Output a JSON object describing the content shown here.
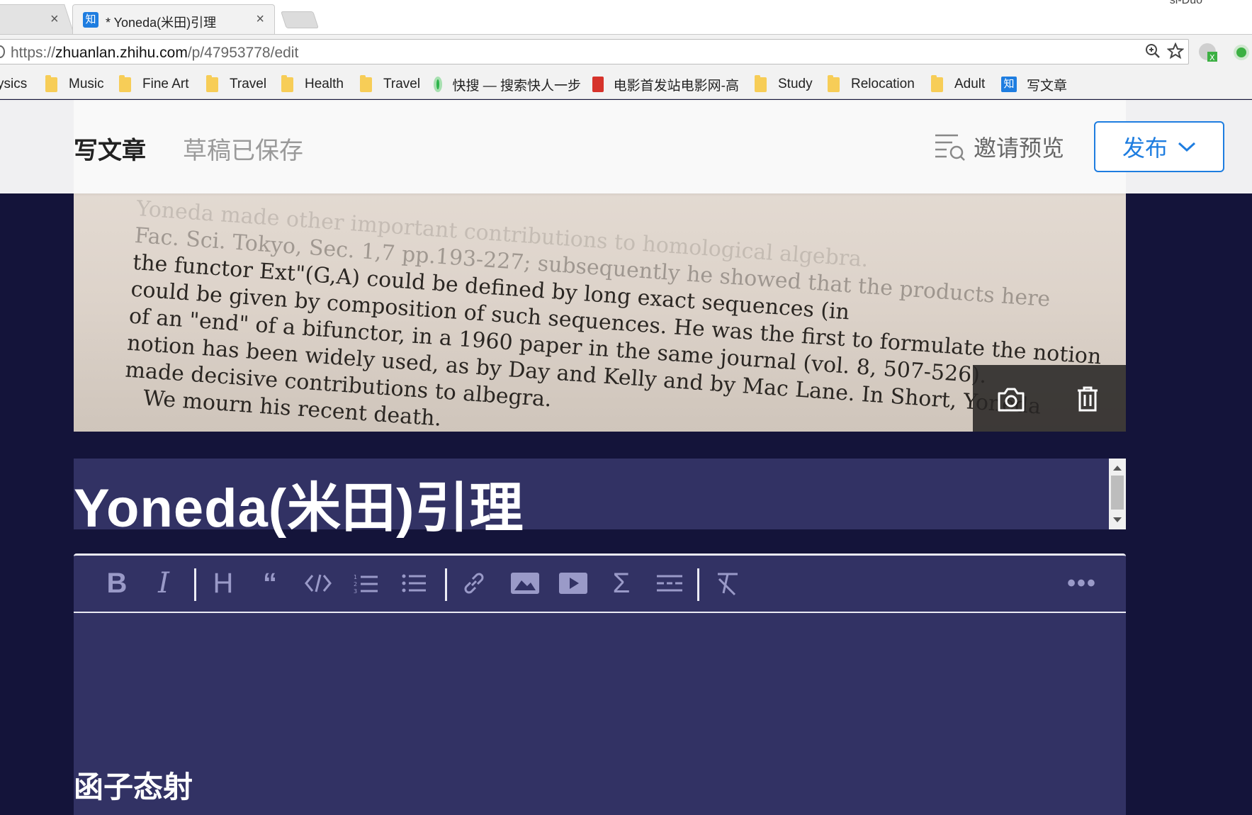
{
  "browser": {
    "active_tab_title": "* Yoneda(米田)引理",
    "profile_name": "si-Duo",
    "url_prefix": "https://",
    "url_domain": "zhuanlan.zhihu.com",
    "url_path": "/p/47953778/edit",
    "favicon_char": "知"
  },
  "bookmarks": [
    {
      "label": "ysics",
      "icon": "folder"
    },
    {
      "label": "Music",
      "icon": "folder"
    },
    {
      "label": "Fine Art",
      "icon": "folder"
    },
    {
      "label": "Travel",
      "icon": "folder"
    },
    {
      "label": "Health",
      "icon": "folder"
    },
    {
      "label": "Travel",
      "icon": "folder"
    },
    {
      "label": "快搜 — 搜索快人一步",
      "icon": "kuaisou-icon"
    },
    {
      "label": "电影首发站电影网-高",
      "icon": "movie-site-icon"
    },
    {
      "label": "Study",
      "icon": "folder"
    },
    {
      "label": "Relocation",
      "icon": "folder"
    },
    {
      "label": "Adult",
      "icon": "folder"
    },
    {
      "label": "写文章",
      "icon": "zhihu-icon"
    }
  ],
  "header": {
    "write_label": "写文章",
    "status_label": "草稿已保存",
    "invite_label": "邀请预览",
    "publish_label": "发布"
  },
  "cover_image_text": [
    "Yoneda made other important contributions to homological algebra.",
    "Fac. Sci. Tokyo, Sec. 1,7 pp.193-227; subsequently he showed that the products here",
    "the functor Ext\"(G,A) could be defined by long exact sequences (in",
    "could be given by composition of such sequences. He was the first to formulate the notion",
    "of an \"end\" of a bifunctor, in a 1960 paper in the same journal (vol. 8, 507-526).",
    "notion has been widely used, as by Day and Kelly and by Mac Lane. In Short, Yoneda",
    "made decisive contributions to albegra.",
    "We mourn his recent death."
  ],
  "article": {
    "title": "Yoneda(米田)引理",
    "first_heading": "函子态射"
  },
  "toolbar_icons": [
    "bold-icon",
    "italic-icon",
    "heading-icon",
    "quote-icon",
    "code-icon",
    "ordered-list-icon",
    "unordered-list-icon",
    "link-icon",
    "image-icon",
    "video-icon",
    "formula-icon",
    "divider-icon",
    "clear-format-icon",
    "more-icon"
  ],
  "colors": {
    "accent": "#1e7de0",
    "page_bg": "#14143a",
    "editor_bg": "#323264"
  }
}
